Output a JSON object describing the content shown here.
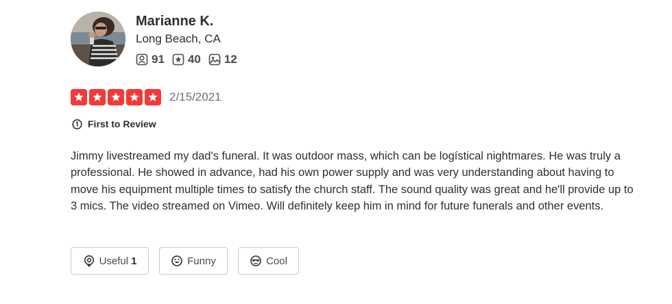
{
  "reviewer": {
    "name": "Marianne K.",
    "location": "Long Beach, CA",
    "stats": {
      "friends": "91",
      "reviews": "40",
      "photos": "12"
    }
  },
  "review": {
    "rating": 5,
    "max_rating": 5,
    "date": "2/15/2021",
    "badge": "First to Review",
    "text": "Jimmy livestreamed my dad's funeral. It was outdoor mass, which can be logístical nightmares. He was truly a professional. He showed in advance, had his own power supply and was very understanding about having to move his equipment multiple times to satisfy the church staff.  The sound quality was great and he'll provide up to 3 mics. The video streamed on Vimeo. Will definitely keep him in mind for future funerals and other events."
  },
  "reactions": {
    "useful_label": "Useful",
    "useful_count": "1",
    "funny_label": "Funny",
    "cool_label": "Cool"
  },
  "colors": {
    "star_red": "#f43939",
    "text_dark": "#2d2e2f",
    "text_muted": "#6e7072",
    "border": "#c8c9ca"
  }
}
